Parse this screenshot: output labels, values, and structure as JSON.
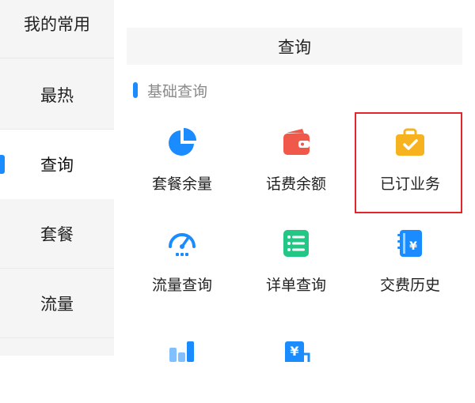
{
  "sidebar": {
    "items": [
      {
        "label": "我的常用"
      },
      {
        "label": "最热"
      },
      {
        "label": "查询"
      },
      {
        "label": "套餐"
      },
      {
        "label": "流量"
      }
    ]
  },
  "main": {
    "header_title": "查询",
    "section_title": "基础查询",
    "grid": [
      {
        "label": "套餐余量",
        "icon": "pie-chart-icon"
      },
      {
        "label": "话费余额",
        "icon": "wallet-icon"
      },
      {
        "label": "已订业务",
        "icon": "briefcase-check-icon"
      },
      {
        "label": "流量查询",
        "icon": "speedometer-icon"
      },
      {
        "label": "详单查询",
        "icon": "list-document-icon"
      },
      {
        "label": "交费历史",
        "icon": "yen-notebook-icon"
      },
      {
        "label": "",
        "icon": "bar-chart-icon"
      },
      {
        "label": "",
        "icon": "yen-receipt-icon"
      }
    ]
  },
  "colors": {
    "accent": "#1a8cff",
    "highlight_border": "#e0262a",
    "wallet": "#f0584a",
    "briefcase": "#f6b21f",
    "list_green": "#22c786"
  }
}
